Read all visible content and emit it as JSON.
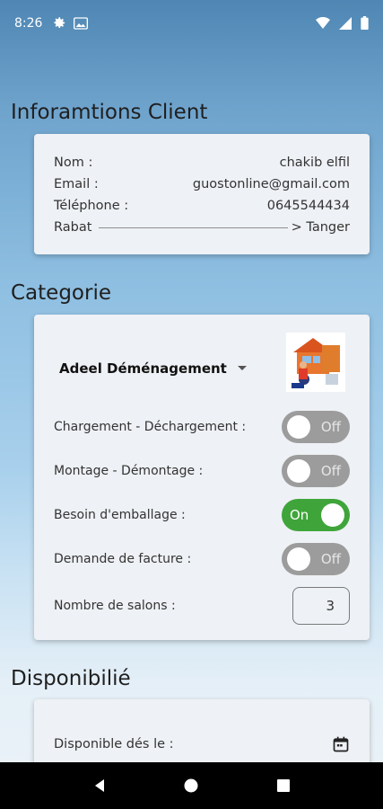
{
  "status_bar": {
    "time": "8:26"
  },
  "client_section": {
    "title": "Inforamtions Client",
    "rows": [
      {
        "label": "Nom :",
        "value": "chakib elfil"
      },
      {
        "label": "Email :",
        "value": "guostonline@gmail.com"
      },
      {
        "label": "Téléphone :",
        "value": "0645544434"
      }
    ],
    "route": {
      "from": "Rabat",
      "to": "> Tanger"
    }
  },
  "category_section": {
    "title": "Categorie",
    "dropdown_value": "Adeel Déménagement",
    "switches": [
      {
        "label": "Chargement - Déchargement :",
        "state": "Off"
      },
      {
        "label": "Montage - Démontage :",
        "state": "Off"
      },
      {
        "label": "Besoin d'emballage :",
        "state": "On"
      },
      {
        "label": "Demande de facture :",
        "state": "Off"
      }
    ],
    "salons": {
      "label": "Nombre de salons :",
      "value": "3"
    }
  },
  "availability_section": {
    "title": "Disponibilié",
    "date_label": "Disponible dés le :"
  },
  "colors": {
    "switch_on": "#3fa53a",
    "switch_off": "#9c9c9c"
  }
}
